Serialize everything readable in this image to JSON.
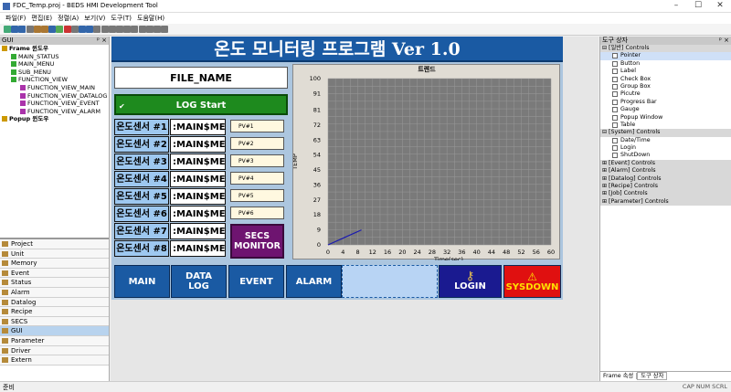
{
  "window": {
    "title": "FDC_Temp.proj - BEDS HMI Development Tool",
    "min": "–",
    "max": "☐",
    "close": "✕"
  },
  "menu": [
    "파일(F)",
    "편집(E)",
    "정렬(A)",
    "보기(V)",
    "도구(T)",
    "도움말(H)"
  ],
  "left": {
    "header": "GUI",
    "header_pin": "ᵖ ×",
    "tree": [
      "Frame 윈도우",
      "MAIN_STATUS",
      "MAIN_MENU",
      "SUB_MENU",
      "FUNCTION_VIEW",
      "FUNCTION_VIEW_MAIN",
      "FUNCTION_VIEW_DATALOG",
      "FUNCTION_VIEW_EVENT",
      "FUNCTION_VIEW_ALARM",
      "Popup 윈도우"
    ],
    "nav": [
      "Project",
      "Unit",
      "Memory",
      "Event",
      "Status",
      "Alarm",
      "Datalog",
      "Recipe",
      "SECS",
      "GUI",
      "Parameter",
      "Driver",
      "Extern"
    ]
  },
  "hmi": {
    "title": "온도 모니터링 프로그램 Ver 1.0",
    "file_name": "FILE_NAME",
    "log_start": "LOG Start",
    "sensors": [
      "온도센서 #1",
      "온도센서 #2",
      "온도센서 #3",
      "온도센서 #4",
      "온도센서 #5",
      "온도센서 #6",
      "온도센서 #7",
      "온도센서 #8"
    ],
    "mem": ":MAIN$MEM_",
    "pv": [
      "PV#1",
      "PV#2",
      "PV#3",
      "PV#4",
      "PV#5",
      "PV#6",
      "PV#7",
      "PV#8"
    ],
    "secs": "SECS\nMONITOR",
    "nav": [
      "MAIN",
      "DATA\nLOG",
      "EVENT",
      "ALARM"
    ],
    "login": "LOGIN",
    "sysdown": "SYSDOWN"
  },
  "chart_data": {
    "type": "line",
    "title": "트렌드",
    "xlabel": "Time(sec)",
    "ylabel": "TEMP",
    "xlim": [
      0,
      60
    ],
    "ylim": [
      0,
      100
    ],
    "xticks": [
      0,
      4,
      8,
      12,
      16,
      20,
      24,
      28,
      32,
      36,
      40,
      44,
      48,
      52,
      56,
      60
    ],
    "yticks": [
      0,
      9,
      18,
      27,
      36,
      45,
      54,
      63,
      72,
      81,
      91,
      100
    ],
    "series": [
      {
        "x": [
          0,
          9
        ],
        "y": [
          0,
          9
        ]
      }
    ],
    "grid": true
  },
  "right": {
    "header": "도구 상자",
    "header_pin": "ᵖ ×",
    "items": [
      {
        "g": true,
        "t": "[일반] Controls"
      },
      {
        "t": "Pointer",
        "sel": true
      },
      {
        "t": "Button"
      },
      {
        "t": "Label"
      },
      {
        "t": "Check Box"
      },
      {
        "t": "Group Box"
      },
      {
        "t": "Picutre"
      },
      {
        "t": "Progress Bar"
      },
      {
        "t": "Gauge"
      },
      {
        "t": "Popup Window"
      },
      {
        "t": "Table"
      },
      {
        "g": true,
        "t": "[System] Controls"
      },
      {
        "t": "Date/Time"
      },
      {
        "t": "Login"
      },
      {
        "t": "ShutDown"
      },
      {
        "g": true,
        "t": "[Event] Controls"
      },
      {
        "g": true,
        "t": "[Alarm] Controls"
      },
      {
        "g": true,
        "t": "[Datalog] Controls"
      },
      {
        "g": true,
        "t": "[Recipe] Controls"
      },
      {
        "g": true,
        "t": "[Job] Controls"
      },
      {
        "g": true,
        "t": "[Parameter] Controls"
      }
    ],
    "tabs": [
      "Frame 속성",
      "도구 상자"
    ]
  },
  "status": {
    "left": "준비",
    "right": "CAP NUM SCRL"
  },
  "colors": {
    "header": "#1a5aa3",
    "log": "#1e8a1e",
    "secs": "#6e1470",
    "sysdown": "#e01010",
    "login": "#1a1a90"
  }
}
